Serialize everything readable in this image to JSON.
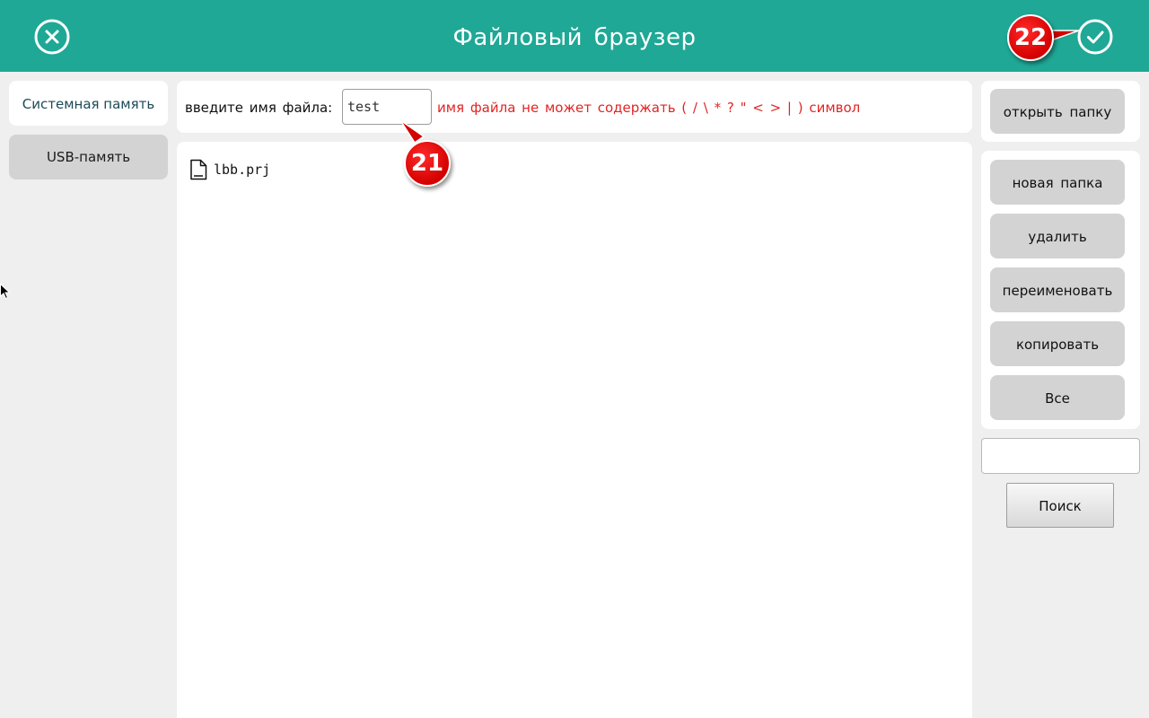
{
  "header": {
    "title": "Файловый браузер",
    "close_icon": "close-circle-icon",
    "confirm_icon": "check-circle-icon",
    "bg_color": "#1fa896"
  },
  "sidebar": {
    "tabs": [
      {
        "label": "Системная память",
        "active": true
      },
      {
        "label": "USB-память",
        "active": false
      }
    ]
  },
  "filename": {
    "label": "введите имя файла:",
    "value": "test",
    "warning": "имя файла не может содержать ( / \\ * ? \" < > | ) символ",
    "warning_color": "#e32424"
  },
  "files": [
    {
      "name": "lbb.prj",
      "icon": "file-icon"
    }
  ],
  "actions": {
    "open_folder": "открыть папку",
    "new_folder": "новая папка",
    "delete": "удалить",
    "rename": "переименовать",
    "copy": "копировать",
    "all": "Все"
  },
  "search": {
    "value": "",
    "button_label": "Поиск"
  },
  "annotations": [
    {
      "number": "21"
    },
    {
      "number": "22"
    }
  ]
}
